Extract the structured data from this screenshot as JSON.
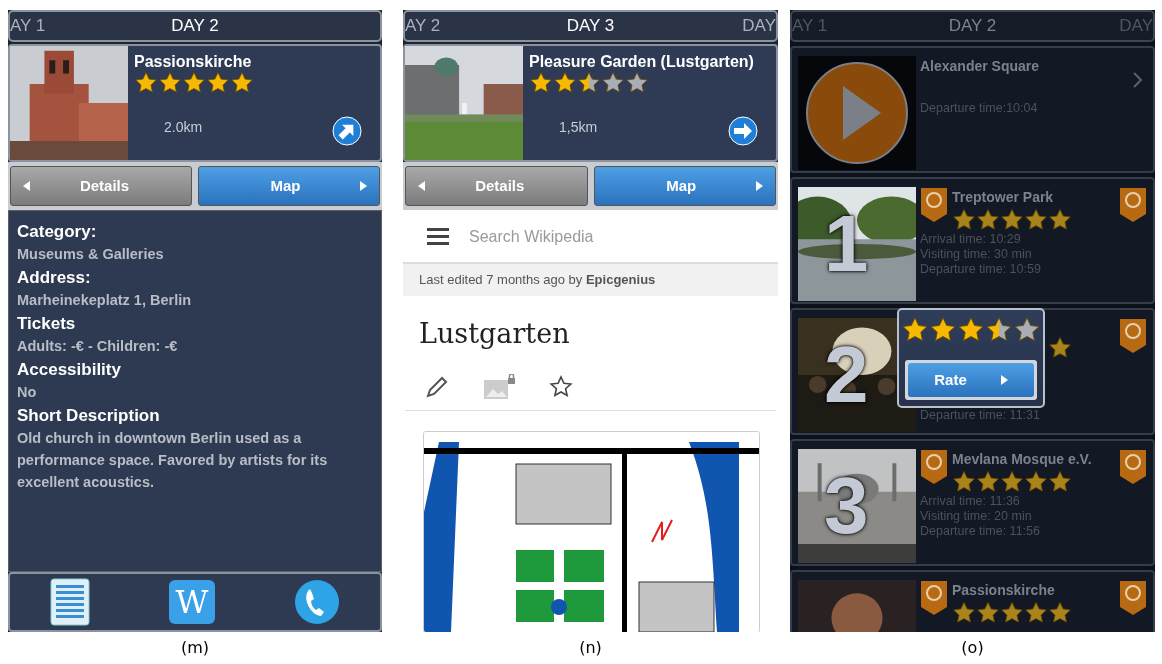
{
  "panels": [
    {
      "kind": "details",
      "caption": "(m)",
      "days": [
        {
          "label": "AY 1",
          "selected": false
        },
        {
          "label": "DAY 2",
          "selected": true
        }
      ],
      "place": {
        "name": "Passionskirche",
        "stars": 5,
        "distance": "2.0km",
        "arrow": {
          "kind": "up_right"
        }
      },
      "buttons": [
        {
          "label": "Details",
          "selected": false
        },
        {
          "label": "Map",
          "selected": true
        }
      ],
      "fields": [
        {
          "label": "Category:",
          "value": "Museums & Galleries"
        },
        {
          "label": "Address:",
          "value": "Marheinekeplatz 1, Berlin"
        },
        {
          "label": "Tickets",
          "value": "Adults: -€ - Children: -€"
        },
        {
          "label": "Accessibility",
          "value": "No"
        },
        {
          "label": "Short Description",
          "value": "Old church in downtown Berlin used as a performance space. Favored by artists for its excellent acoustics."
        }
      ],
      "toolbar": [
        {
          "kind": "list"
        },
        {
          "kind": "wiki",
          "label": "W"
        },
        {
          "kind": "phone"
        }
      ]
    },
    {
      "kind": "wiki",
      "caption": "(n)",
      "days": [
        {
          "label": "AY 2",
          "selected": false
        },
        {
          "label": "DAY 3",
          "selected": true
        },
        {
          "label": "DAY",
          "selected": false
        }
      ],
      "place": {
        "name": "Pleasure Garden (Lustgarten)",
        "stars": 2.5,
        "distance": "1,5km",
        "arrow": {
          "kind": "right"
        }
      },
      "buttons": [
        {
          "label": "Details",
          "selected": false
        },
        {
          "label": "Map",
          "selected": true
        }
      ],
      "wiki": {
        "placeholder": "Search Wikipedia",
        "edited": "Last edited 7 months ago by **Epicgenius**",
        "title": "Lustgarten"
      }
    },
    {
      "kind": "itinerary",
      "caption": "(o)",
      "days": [
        {
          "label": "AY 1",
          "selected": false
        },
        {
          "label": "DAY 2",
          "selected": true
        },
        {
          "label": "DAY",
          "selected": false
        }
      ],
      "items": [
        {
          "kind": "start",
          "name": "Alexander Square",
          "times": [
            "Departure time:10:04"
          ]
        },
        {
          "kind": "stop",
          "number": "1",
          "name": "Treptower Park",
          "stars": 5,
          "times": [
            "Arrival time: 10:29",
            "Visiting time: 30 min",
            "Departure time: 10:59"
          ]
        },
        {
          "kind": "stop",
          "number": "2",
          "times": [
            "Departure time: 11:31"
          ]
        },
        {
          "kind": "stop",
          "number": "3",
          "name": "Mevlana Mosque e.V.",
          "stars": 5,
          "times": [
            "Arrival time: 11:36",
            "Visiting time: 20 min",
            "Departure time: 11:56"
          ]
        },
        {
          "kind": "stop",
          "name": "Passionskirche",
          "stars": 5
        }
      ],
      "popup": {
        "stars": 3.5,
        "button": "Rate"
      }
    }
  ]
}
